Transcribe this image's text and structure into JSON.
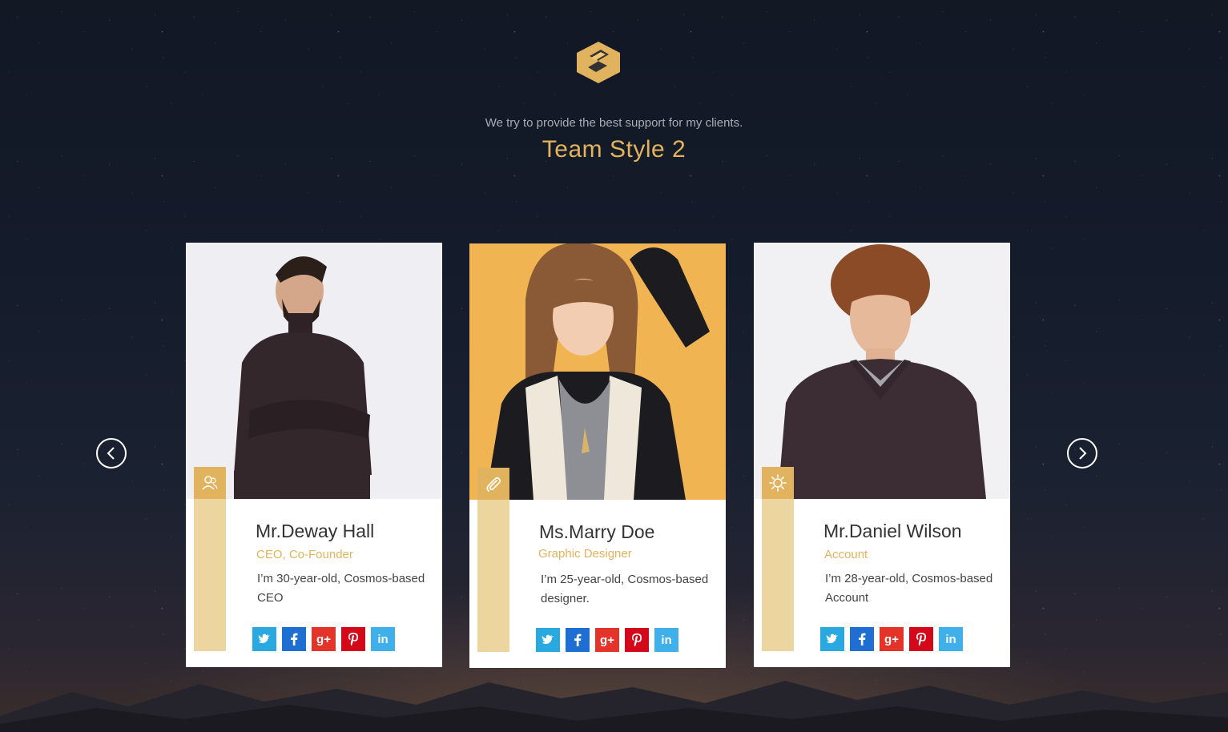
{
  "header": {
    "subtitle": "We try to provide the best support for my clients.",
    "title": "Team Style 2"
  },
  "colors": {
    "accent": "#e2b35e",
    "accent_light": "#ecd59f",
    "twitter": "#2aa9e0",
    "facebook": "#1f6fd2",
    "google_plus": "#e4342a",
    "pinterest": "#d4081b",
    "linkedin": "#3fb0ea"
  },
  "carousel": {
    "prev_icon": "chevron-left-icon",
    "next_icon": "chevron-right-icon"
  },
  "members": [
    {
      "name": "Mr.Deway Hall",
      "position": "CEO, Co-Founder",
      "bio": "I’m 30-year-old, Cosmos-based CEO",
      "badge_icon": "users-icon",
      "socials": [
        "twitter-icon",
        "facebook-icon",
        "google-plus-icon",
        "pinterest-icon",
        "linkedin-icon"
      ]
    },
    {
      "name": "Ms.Marry Doe",
      "position": "Graphic Designer",
      "bio": "I’m 25-year-old, Cosmos-based designer.",
      "badge_icon": "paperclip-icon",
      "socials": [
        "twitter-icon",
        "facebook-icon",
        "google-plus-icon",
        "pinterest-icon",
        "linkedin-icon"
      ]
    },
    {
      "name": "Mr.Daniel Wilson",
      "position": "Account",
      "bio": "I’m 28-year-old, Cosmos-based Account",
      "badge_icon": "gear-icon",
      "socials": [
        "twitter-icon",
        "facebook-icon",
        "google-plus-icon",
        "pinterest-icon",
        "linkedin-icon"
      ]
    }
  ],
  "social_labels": {
    "google_plus": "g+",
    "linkedin": "in"
  }
}
